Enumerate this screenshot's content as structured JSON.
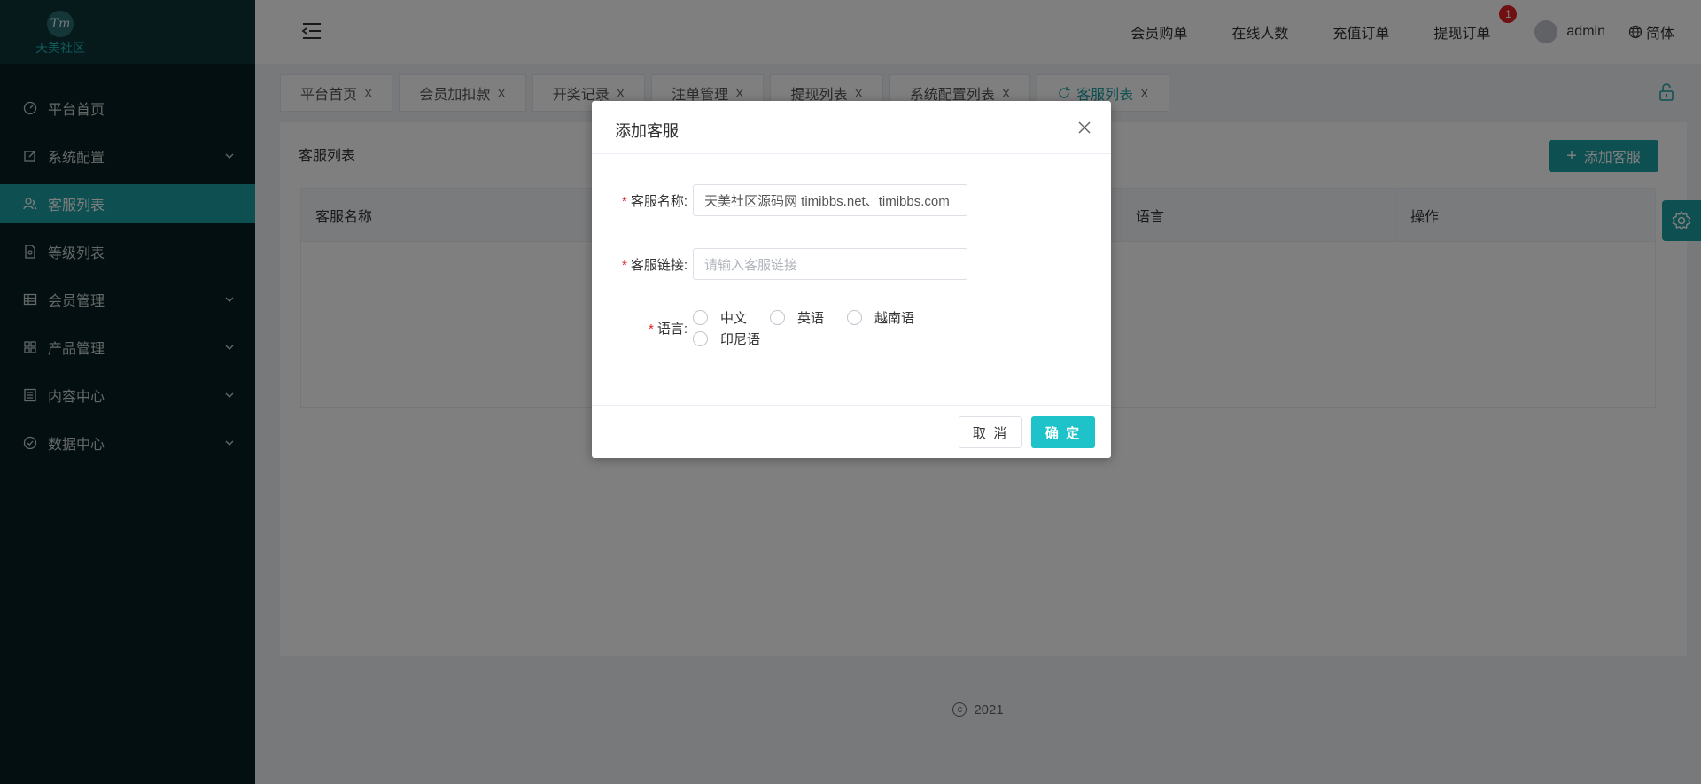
{
  "logo": {
    "mark": "Tm",
    "text": "天美社区"
  },
  "sidebar": {
    "items": [
      {
        "label": "平台首页",
        "icon": "dashboard-icon",
        "active": false,
        "expandable": false
      },
      {
        "label": "系统配置",
        "icon": "edit-icon",
        "active": false,
        "expandable": true
      },
      {
        "label": "客服列表",
        "icon": "users-icon",
        "active": true,
        "expandable": false
      },
      {
        "label": "等级列表",
        "icon": "document-icon",
        "active": false,
        "expandable": false
      },
      {
        "label": "会员管理",
        "icon": "grid-icon",
        "active": false,
        "expandable": true
      },
      {
        "label": "产品管理",
        "icon": "apps-icon",
        "active": false,
        "expandable": true
      },
      {
        "label": "内容中心",
        "icon": "list-icon",
        "active": false,
        "expandable": true
      },
      {
        "label": "数据中心",
        "icon": "check-circle-icon",
        "active": false,
        "expandable": true
      }
    ]
  },
  "header": {
    "links": [
      "会员购单",
      "在线人数",
      "充值订单",
      "提现订单"
    ],
    "badge": "1",
    "user": "admin",
    "language": "简体"
  },
  "tabs": [
    {
      "label": "平台首页",
      "active": false
    },
    {
      "label": "会员加扣款",
      "active": false
    },
    {
      "label": "开奖记录",
      "active": false
    },
    {
      "label": "注单管理",
      "active": false
    },
    {
      "label": "提现列表",
      "active": false
    },
    {
      "label": "系统配置列表",
      "active": false
    },
    {
      "label": "客服列表",
      "active": true
    }
  ],
  "tab_close": "X",
  "main": {
    "title": "客服列表",
    "add_button": "添加客服",
    "columns": [
      "客服名称",
      "语言",
      "操作"
    ]
  },
  "footer": {
    "year": "2021",
    "copyright_symbol": "c"
  },
  "dialog": {
    "title": "添加客服",
    "name_label": "客服名称:",
    "name_value": "天美社区源码网 timibbs.net、timibbs.com",
    "link_label": "客服链接:",
    "link_placeholder": "请输入客服链接",
    "lang_label": "语言:",
    "languages": [
      "中文",
      "英语",
      "越南语",
      "印尼语"
    ],
    "cancel": "取 消",
    "confirm": "确 定"
  },
  "colors": {
    "accent": "#1d9ea3",
    "sidebar_bg": "#071f21",
    "confirm": "#1ec3c9",
    "badge": "#e02020"
  }
}
